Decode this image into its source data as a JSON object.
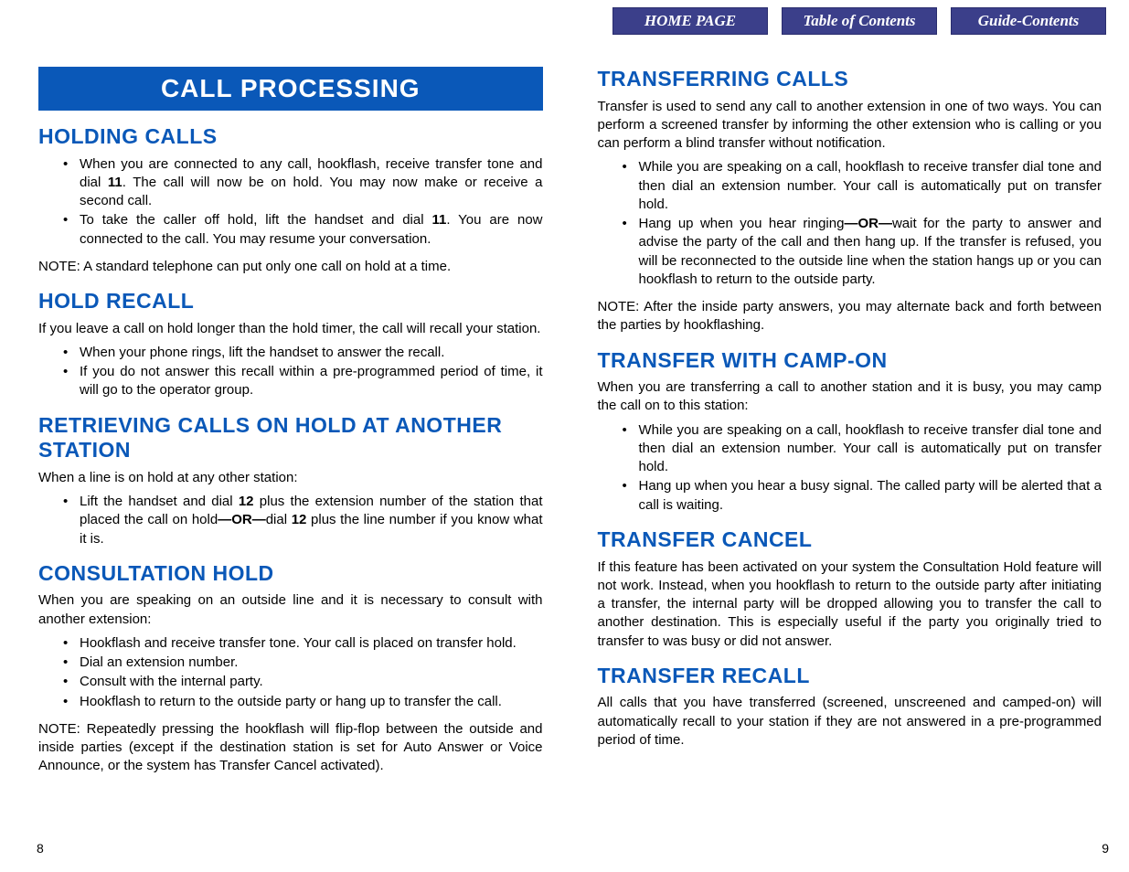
{
  "nav": {
    "home": "HOME PAGE",
    "toc": "Table of Contents",
    "guide": "Guide-Contents"
  },
  "left": {
    "banner": "CALL PROCESSING",
    "s1": {
      "title": "HOLDING CALLS",
      "li1a": "When you are connected to any call, hookflash, receive transfer tone and dial ",
      "li1b": "11",
      "li1c": ". The call will now be on hold. You may now make or receive a second call.",
      "li2a": "To take the caller off hold, lift the handset and dial ",
      "li2b": "11",
      "li2c": ". You are now connected to the call. You may resume your conversation.",
      "note": "NOTE: A standard telephone can put only one call on hold at a time."
    },
    "s2": {
      "title": "HOLD RECALL",
      "intro": "If you leave a call on hold longer than the hold timer, the call will recall your station.",
      "li1": "When your phone rings, lift the handset to answer the recall.",
      "li2": "If you do not answer this recall within a pre-programmed period of time, it will go to the operator group."
    },
    "s3": {
      "title": "RETRIEVING CALLS ON HOLD AT ANOTHER STATION",
      "intro": "When a line is on hold at any other station:",
      "li1a": "Lift the handset and dial ",
      "li1b": "12",
      "li1c": " plus the extension number of the station that placed the call on hold",
      "li1d": "—OR—",
      "li1e": "dial ",
      "li1f": "12",
      "li1g": " plus the line number if you know what it is."
    },
    "s4": {
      "title": "CONSULTATION HOLD",
      "intro": "When you are speaking on an outside line and it is necessary to consult with another extension:",
      "li1": "Hookflash and receive transfer tone. Your call is placed on transfer hold.",
      "li2": "Dial an extension number.",
      "li3": "Consult with the internal party.",
      "li4": "Hookflash to return to the outside party or hang up to transfer the call.",
      "note": "NOTE: Repeatedly pressing the hookflash will flip-flop between the outside and inside parties (except if the destination station is set for Auto Answer or Voice Announce, or the system has Transfer Cancel activated)."
    },
    "pageNum": "8"
  },
  "right": {
    "s1": {
      "title": "TRANSFERRING CALLS",
      "intro": "Transfer is used to send any call to another extension in one of two ways. You can perform a screened transfer by informing the other extension who is calling or you can perform a blind transfer without notification.",
      "li1": "While you are speaking on a call, hookflash to receive transfer dial tone and then dial an extension number. Your call is automatically put on transfer hold.",
      "li2a": "Hang up when you hear ringing",
      "li2b": "—OR—",
      "li2c": "wait for the party to answer and advise the party of the call and then hang up. If the transfer is refused, you will be reconnected to the outside line when the station hangs up or you can hookflash to return to the outside party.",
      "note": "NOTE: After the inside party answers, you may alternate back and forth between the parties by hookflashing."
    },
    "s2": {
      "title": "TRANSFER WITH CAMP-ON",
      "intro": "When you are transferring a call to another station and it is busy, you may camp the call on to this station:",
      "li1": "While you are speaking on a call, hookflash to receive transfer dial tone and then dial an extension number. Your call is automatically put on transfer hold.",
      "li2": "Hang up when you hear a busy signal. The called party will be alerted that a call is waiting."
    },
    "s3": {
      "title": "TRANSFER CANCEL",
      "body": "If this feature has been activated on your system the Consultation Hold feature will not work. Instead, when you hookflash to return to the outside party after initiating a transfer, the internal party will be dropped allowing you to transfer the call to another destination. This is especially useful if the party you originally tried to transfer to was busy or did not answer."
    },
    "s4": {
      "title": "TRANSFER RECALL",
      "body": "All calls that you have transferred (screened, unscreened and camped-on) will automatically recall to your station if they are not answered in a pre-programmed period of time."
    },
    "pageNum": "9"
  }
}
